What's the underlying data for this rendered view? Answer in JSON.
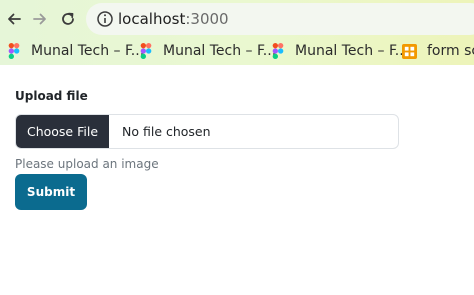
{
  "browser": {
    "url_host": "localhost",
    "url_port": ":3000",
    "bookmarks": [
      {
        "label": "Munal Tech – F...",
        "icon": "figma-icon"
      },
      {
        "label": "Munal Tech – F...",
        "icon": "figma-icon"
      },
      {
        "label": "Munal Tech – F...",
        "icon": "figma-icon"
      },
      {
        "label": "form sch",
        "icon": "grid-app-icon"
      }
    ]
  },
  "form": {
    "upload_label": "Upload file",
    "choose_button": "Choose File",
    "file_status": "No file chosen",
    "hint": "Please upload an image",
    "submit_label": "Submit"
  },
  "colors": {
    "submit": "#0b6b8f",
    "choose_button": "#2a2f3a",
    "hint_text": "#6c757d"
  }
}
